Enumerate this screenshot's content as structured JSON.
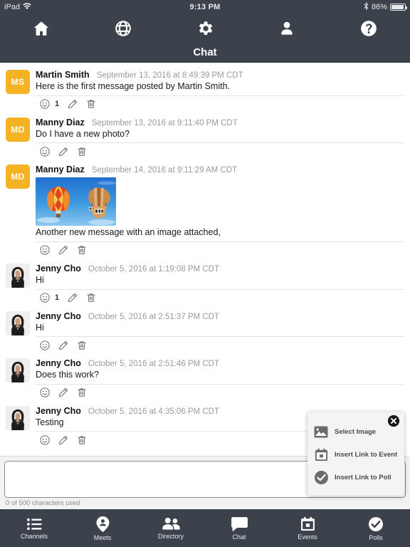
{
  "statusbar": {
    "device": "iPad",
    "wifi_icon": "wifi-icon",
    "time": "9:13 PM",
    "bluetooth_icon": "bluetooth-icon",
    "battery_percent": "86%"
  },
  "topnav": {
    "items": [
      {
        "name": "home-icon",
        "label": "Home"
      },
      {
        "name": "globe-icon",
        "label": "Globe"
      },
      {
        "name": "gear-icon",
        "label": "Settings"
      },
      {
        "name": "person-icon",
        "label": "Profile"
      },
      {
        "name": "help-icon",
        "label": "Help"
      }
    ]
  },
  "titlebar": {
    "title": "Chat"
  },
  "messages": [
    {
      "author": "Martin Smith",
      "time": "September 13, 2016 at 8:49:39 PM CDT",
      "text": "Here is the first message posted by Martin Smith.",
      "avatar_type": "initials",
      "avatar_initials": "MS",
      "avatar_color": "#f5b324",
      "reaction_count": "1",
      "has_image": false
    },
    {
      "author": "Manny Diaz",
      "time": "September 13, 2016 at 9:11:40 PM CDT",
      "text": "Do I have a new photo?",
      "avatar_type": "initials",
      "avatar_initials": "MD",
      "avatar_color": "#f5b324",
      "reaction_count": "",
      "has_image": false
    },
    {
      "author": "Manny Diaz",
      "time": "September 14, 2016 at 9:11:29 AM CDT",
      "text": "Another new message with an image attached,",
      "avatar_type": "initials",
      "avatar_initials": "MD",
      "avatar_color": "#f5b324",
      "reaction_count": "",
      "has_image": true,
      "image_alt": "hot-air-balloons-photo"
    },
    {
      "author": "Jenny Cho",
      "time": "October 5, 2016 at 1:19:08 PM CDT",
      "text": "Hi",
      "avatar_type": "photo",
      "avatar_initials": "",
      "avatar_color": "#efefef",
      "reaction_count": "1",
      "has_image": false
    },
    {
      "author": "Jenny Cho",
      "time": "October 5, 2016 at 2:51:37 PM CDT",
      "text": "Hi",
      "avatar_type": "photo",
      "avatar_initials": "",
      "avatar_color": "#efefef",
      "reaction_count": "",
      "has_image": false
    },
    {
      "author": "Jenny Cho",
      "time": "October 5, 2016 at 2:51:46 PM CDT",
      "text": "Does this work?",
      "avatar_type": "photo",
      "avatar_initials": "",
      "avatar_color": "#efefef",
      "reaction_count": "",
      "has_image": false
    },
    {
      "author": "Jenny Cho",
      "time": "October 5, 2016 at 4:35:06 PM CDT",
      "text": "Testing",
      "avatar_type": "photo",
      "avatar_initials": "",
      "avatar_color": "#efefef",
      "reaction_count": "",
      "has_image": false
    }
  ],
  "composer": {
    "value": "",
    "placeholder": "",
    "char_count_label": "0 of 500 characters used"
  },
  "attachment_popup": {
    "close_icon": "close-icon",
    "items": [
      {
        "icon": "image-icon",
        "label": "Select Image"
      },
      {
        "icon": "calendar-icon",
        "label": "Insert Link to Event"
      },
      {
        "icon": "check-circle-icon",
        "label": "Insert Link to Poll"
      }
    ]
  },
  "tabbar": {
    "items": [
      {
        "icon": "list-icon",
        "label": "Channels"
      },
      {
        "icon": "pin-person-icon",
        "label": "Meets"
      },
      {
        "icon": "people-icon",
        "label": "Directory"
      },
      {
        "icon": "chat-bubble-icon",
        "label": "Chat"
      },
      {
        "icon": "calendar-icon",
        "label": "Events"
      },
      {
        "icon": "check-circle-icon",
        "label": "Polls"
      }
    ]
  },
  "colors": {
    "chrome": "#3b424c",
    "accent_avatar": "#f5b324",
    "composer_bg": "#f2f2f2"
  }
}
